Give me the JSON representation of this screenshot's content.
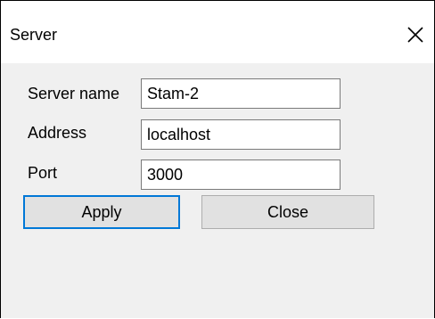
{
  "window": {
    "title": "Server",
    "close_glyph": "close-icon"
  },
  "form": {
    "server_name_label": "Server name",
    "server_name_value": "Stam-2",
    "address_label": "Address",
    "address_value": "localhost",
    "port_label": "Port",
    "port_value": "3000"
  },
  "buttons": {
    "apply_label": "Apply",
    "close_label": "Close"
  },
  "colors": {
    "focus_border": "#0078d7",
    "button_face": "#e1e1e1",
    "dialog_background": "#f0f0f0"
  }
}
